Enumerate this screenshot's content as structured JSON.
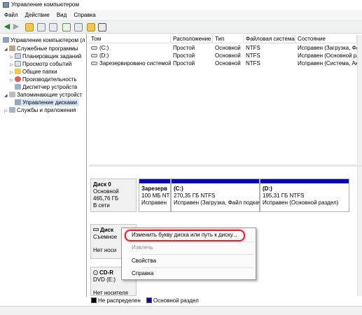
{
  "window": {
    "title": "Управление компьютером"
  },
  "menu": [
    "Файл",
    "Действие",
    "Вид",
    "Справка"
  ],
  "tree": [
    {
      "label": "Управление компьютером (л",
      "indent": 0,
      "icon": "computer-icon"
    },
    {
      "label": "Служебные программы",
      "indent": 1,
      "icon": "tools-icon"
    },
    {
      "label": "Планировщик заданий",
      "indent": 2,
      "icon": "clock-icon"
    },
    {
      "label": "Просмотр событий",
      "indent": 2,
      "icon": "event-viewer-icon"
    },
    {
      "label": "Общие папки",
      "indent": 2,
      "icon": "folder-icon"
    },
    {
      "label": "Производительность",
      "indent": 2,
      "icon": "performance-icon"
    },
    {
      "label": "Диспетчер устройств",
      "indent": 2,
      "icon": "device-manager-icon"
    },
    {
      "label": "Запоминающие устройст",
      "indent": 1,
      "icon": "storage-icon"
    },
    {
      "label": "Управление дисками",
      "indent": 2,
      "icon": "disk-management-icon",
      "selected": true
    },
    {
      "label": "Службы и приложения",
      "indent": 1,
      "icon": "services-icon"
    }
  ],
  "table": {
    "headers": [
      "Том",
      "Расположение",
      "Тип",
      "Файловая система",
      "Состояние"
    ],
    "rows": [
      [
        "(C:)",
        "Простой",
        "Основной",
        "NTFS",
        "Исправен (Загрузка, Файл подкачки, Аварийный дамп, Основной раздел)"
      ],
      [
        "(D:)",
        "Простой",
        "Основной",
        "NTFS",
        "Исправен (Основной раздел)"
      ],
      [
        "Зарезервировано системой",
        "Простой",
        "Основной",
        "NTFS",
        "Исправен (Система, Активен, Основной раздел)"
      ]
    ]
  },
  "disks": {
    "disk0": {
      "name": "Диск 0",
      "type": "Основной",
      "size": "465,76 ГБ",
      "status": "В сети",
      "partitions": [
        {
          "name": "Зарезерв",
          "info": "100 МБ NT",
          "status": "Исправен"
        },
        {
          "name": "(C:)",
          "info": "270,35 ГБ NTFS",
          "status": "Исправен (Загрузка, Файл подкачки"
        },
        {
          "name": "(D:)",
          "info": "195,31 ГБ NTFS",
          "status": "Исправен (Основной раздел)"
        }
      ]
    },
    "disk1": {
      "name": "Диск",
      "type": "Съемное",
      "status": "Нет носи"
    },
    "cdrom": {
      "name": "CD-R",
      "type": "DVD (E:)",
      "status": "Нет носителя"
    }
  },
  "context_menu": {
    "items": [
      {
        "label": "Изменить букву диска или путь к диску...",
        "enabled": true
      },
      {
        "label": "Извлечь",
        "enabled": false
      },
      {
        "label": "Свойства",
        "enabled": true
      },
      {
        "label": "Справка",
        "enabled": true
      }
    ]
  },
  "legend": [
    {
      "label": "Не распределен",
      "color": "#000000"
    },
    {
      "label": "Основной раздел",
      "color": "#0a0aa6"
    }
  ],
  "colors": {
    "partition_bar": "#0a0aa6",
    "highlight": "#d8242b",
    "selection": "#d9e8fb"
  }
}
